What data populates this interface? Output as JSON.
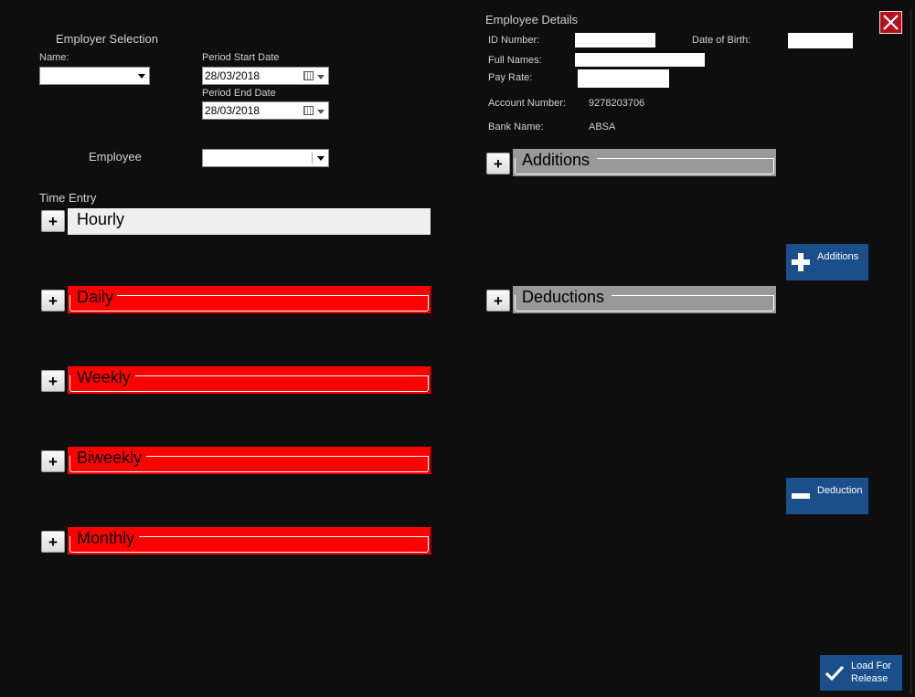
{
  "employer_selection": {
    "title": "Employer Selection",
    "name_label": "Name:",
    "name_value": "",
    "period_start_label": "Period Start Date",
    "period_start_value": "28/03/2018",
    "period_end_label": "Period End Date",
    "period_end_value": "28/03/2018"
  },
  "employee": {
    "label": "Employee",
    "value": ""
  },
  "time_entry": {
    "title": "Time Entry",
    "panels": [
      {
        "label": "Hourly",
        "color": "#efefef"
      },
      {
        "label": "Daily",
        "color": "#fe0000"
      },
      {
        "label": "Weekly",
        "color": "#fe0000"
      },
      {
        "label": "Biweekly",
        "color": "#fe0000"
      },
      {
        "label": "Monthly",
        "color": "#fe0000"
      }
    ],
    "expand_label": "+"
  },
  "employee_details": {
    "title": "Employee Details",
    "id_label": "ID Number:",
    "id_value": "",
    "dob_label": "Date of Birth:",
    "dob_value": "",
    "full_names_label": "Full Names:",
    "full_names_value": "",
    "pay_rate_label": "Pay Rate:",
    "pay_rate_value": "",
    "account_label": "Account Number:",
    "account_value": "9278203706",
    "bank_label": "Bank Name:",
    "bank_value": "ABSA"
  },
  "additions_panel": {
    "label": "Additions",
    "expand_label": "+"
  },
  "deductions_panel": {
    "label": "Deductions",
    "expand_label": "+"
  },
  "buttons": {
    "additions": "Additions",
    "deduction": "Deduction",
    "load_for_release_line1": "Load For",
    "load_for_release_line2": "Release"
  },
  "colors": {
    "background": "#0e0e0e",
    "red_panel": "#fe0000",
    "gray_panel": "#999999",
    "action_blue": "#1a4f8c",
    "close_red": "#b3121c"
  }
}
